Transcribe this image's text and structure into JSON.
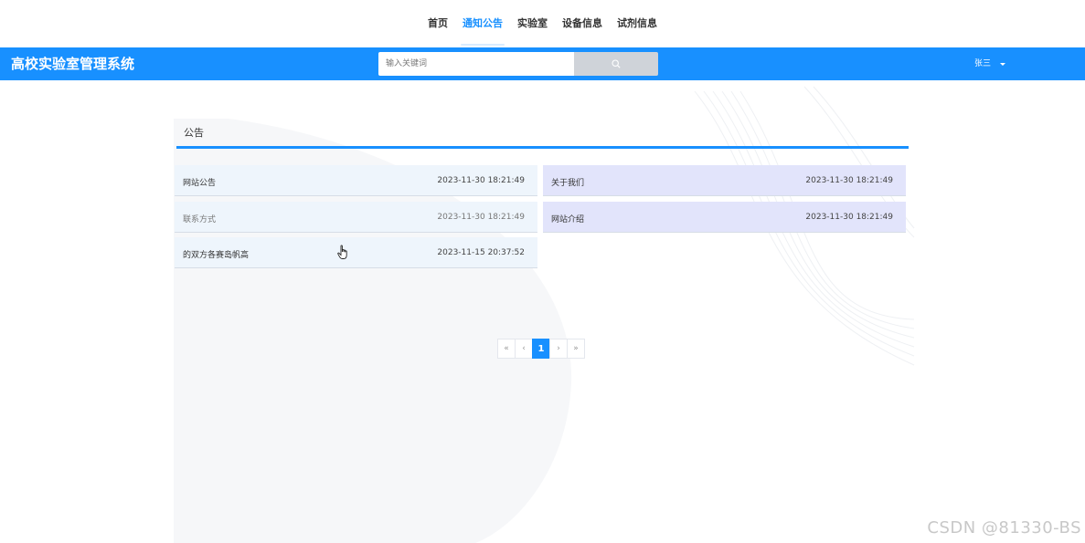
{
  "topnav": {
    "items": [
      {
        "label": "首页",
        "active": false
      },
      {
        "label": "通知公告",
        "active": true
      },
      {
        "label": "实验室",
        "active": false
      },
      {
        "label": "设备信息",
        "active": false
      },
      {
        "label": "试剂信息",
        "active": false
      }
    ]
  },
  "header": {
    "brand": "高校实验室管理系统",
    "search_placeholder": "输入关键词",
    "user_name": "张三",
    "accent_color": "#1890ff"
  },
  "section": {
    "title": "公告"
  },
  "notices": [
    {
      "title": "网站公告",
      "time": "2023-11-30 18:21:49"
    },
    {
      "title": "关于我们",
      "time": "2023-11-30 18:21:49"
    },
    {
      "title": "联系方式",
      "time": "2023-11-30 18:21:49"
    },
    {
      "title": "网站介绍",
      "time": "2023-11-30 18:21:49"
    },
    {
      "title": "的双方各赛岛帆高",
      "time": "2023-11-15 20:37:52"
    }
  ],
  "pagination": {
    "first": "«",
    "prev": "‹",
    "current": "1",
    "next": "›",
    "last": "»"
  },
  "watermark": "CSDN @81330-BS"
}
